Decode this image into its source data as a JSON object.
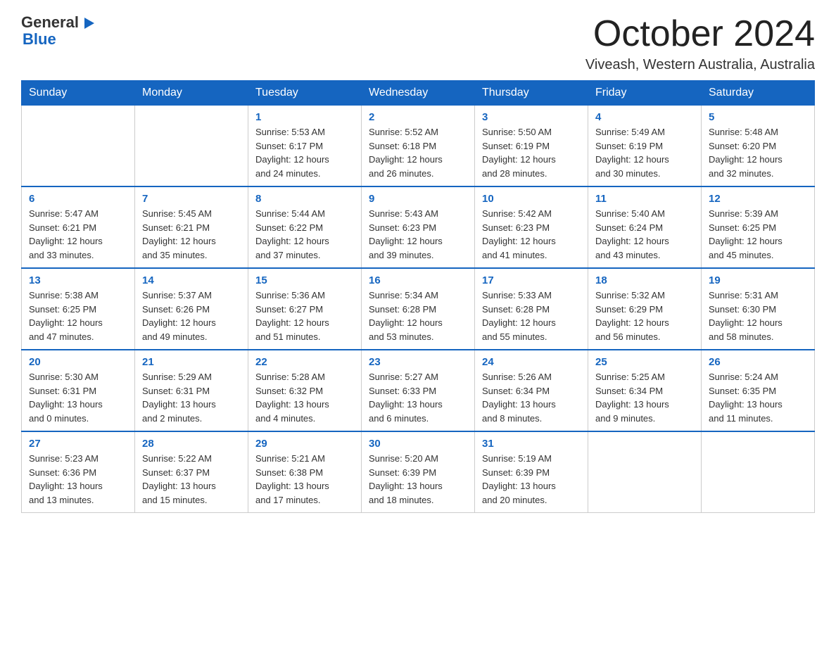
{
  "logo": {
    "text_general": "General",
    "text_blue": "Blue"
  },
  "header": {
    "title": "October 2024",
    "subtitle": "Viveash, Western Australia, Australia"
  },
  "calendar": {
    "days_of_week": [
      "Sunday",
      "Monday",
      "Tuesday",
      "Wednesday",
      "Thursday",
      "Friday",
      "Saturday"
    ],
    "weeks": [
      [
        {
          "day": "",
          "info": ""
        },
        {
          "day": "",
          "info": ""
        },
        {
          "day": "1",
          "info": "Sunrise: 5:53 AM\nSunset: 6:17 PM\nDaylight: 12 hours\nand 24 minutes."
        },
        {
          "day": "2",
          "info": "Sunrise: 5:52 AM\nSunset: 6:18 PM\nDaylight: 12 hours\nand 26 minutes."
        },
        {
          "day": "3",
          "info": "Sunrise: 5:50 AM\nSunset: 6:19 PM\nDaylight: 12 hours\nand 28 minutes."
        },
        {
          "day": "4",
          "info": "Sunrise: 5:49 AM\nSunset: 6:19 PM\nDaylight: 12 hours\nand 30 minutes."
        },
        {
          "day": "5",
          "info": "Sunrise: 5:48 AM\nSunset: 6:20 PM\nDaylight: 12 hours\nand 32 minutes."
        }
      ],
      [
        {
          "day": "6",
          "info": "Sunrise: 5:47 AM\nSunset: 6:21 PM\nDaylight: 12 hours\nand 33 minutes."
        },
        {
          "day": "7",
          "info": "Sunrise: 5:45 AM\nSunset: 6:21 PM\nDaylight: 12 hours\nand 35 minutes."
        },
        {
          "day": "8",
          "info": "Sunrise: 5:44 AM\nSunset: 6:22 PM\nDaylight: 12 hours\nand 37 minutes."
        },
        {
          "day": "9",
          "info": "Sunrise: 5:43 AM\nSunset: 6:23 PM\nDaylight: 12 hours\nand 39 minutes."
        },
        {
          "day": "10",
          "info": "Sunrise: 5:42 AM\nSunset: 6:23 PM\nDaylight: 12 hours\nand 41 minutes."
        },
        {
          "day": "11",
          "info": "Sunrise: 5:40 AM\nSunset: 6:24 PM\nDaylight: 12 hours\nand 43 minutes."
        },
        {
          "day": "12",
          "info": "Sunrise: 5:39 AM\nSunset: 6:25 PM\nDaylight: 12 hours\nand 45 minutes."
        }
      ],
      [
        {
          "day": "13",
          "info": "Sunrise: 5:38 AM\nSunset: 6:25 PM\nDaylight: 12 hours\nand 47 minutes."
        },
        {
          "day": "14",
          "info": "Sunrise: 5:37 AM\nSunset: 6:26 PM\nDaylight: 12 hours\nand 49 minutes."
        },
        {
          "day": "15",
          "info": "Sunrise: 5:36 AM\nSunset: 6:27 PM\nDaylight: 12 hours\nand 51 minutes."
        },
        {
          "day": "16",
          "info": "Sunrise: 5:34 AM\nSunset: 6:28 PM\nDaylight: 12 hours\nand 53 minutes."
        },
        {
          "day": "17",
          "info": "Sunrise: 5:33 AM\nSunset: 6:28 PM\nDaylight: 12 hours\nand 55 minutes."
        },
        {
          "day": "18",
          "info": "Sunrise: 5:32 AM\nSunset: 6:29 PM\nDaylight: 12 hours\nand 56 minutes."
        },
        {
          "day": "19",
          "info": "Sunrise: 5:31 AM\nSunset: 6:30 PM\nDaylight: 12 hours\nand 58 minutes."
        }
      ],
      [
        {
          "day": "20",
          "info": "Sunrise: 5:30 AM\nSunset: 6:31 PM\nDaylight: 13 hours\nand 0 minutes."
        },
        {
          "day": "21",
          "info": "Sunrise: 5:29 AM\nSunset: 6:31 PM\nDaylight: 13 hours\nand 2 minutes."
        },
        {
          "day": "22",
          "info": "Sunrise: 5:28 AM\nSunset: 6:32 PM\nDaylight: 13 hours\nand 4 minutes."
        },
        {
          "day": "23",
          "info": "Sunrise: 5:27 AM\nSunset: 6:33 PM\nDaylight: 13 hours\nand 6 minutes."
        },
        {
          "day": "24",
          "info": "Sunrise: 5:26 AM\nSunset: 6:34 PM\nDaylight: 13 hours\nand 8 minutes."
        },
        {
          "day": "25",
          "info": "Sunrise: 5:25 AM\nSunset: 6:34 PM\nDaylight: 13 hours\nand 9 minutes."
        },
        {
          "day": "26",
          "info": "Sunrise: 5:24 AM\nSunset: 6:35 PM\nDaylight: 13 hours\nand 11 minutes."
        }
      ],
      [
        {
          "day": "27",
          "info": "Sunrise: 5:23 AM\nSunset: 6:36 PM\nDaylight: 13 hours\nand 13 minutes."
        },
        {
          "day": "28",
          "info": "Sunrise: 5:22 AM\nSunset: 6:37 PM\nDaylight: 13 hours\nand 15 minutes."
        },
        {
          "day": "29",
          "info": "Sunrise: 5:21 AM\nSunset: 6:38 PM\nDaylight: 13 hours\nand 17 minutes."
        },
        {
          "day": "30",
          "info": "Sunrise: 5:20 AM\nSunset: 6:39 PM\nDaylight: 13 hours\nand 18 minutes."
        },
        {
          "day": "31",
          "info": "Sunrise: 5:19 AM\nSunset: 6:39 PM\nDaylight: 13 hours\nand 20 minutes."
        },
        {
          "day": "",
          "info": ""
        },
        {
          "day": "",
          "info": ""
        }
      ]
    ]
  }
}
